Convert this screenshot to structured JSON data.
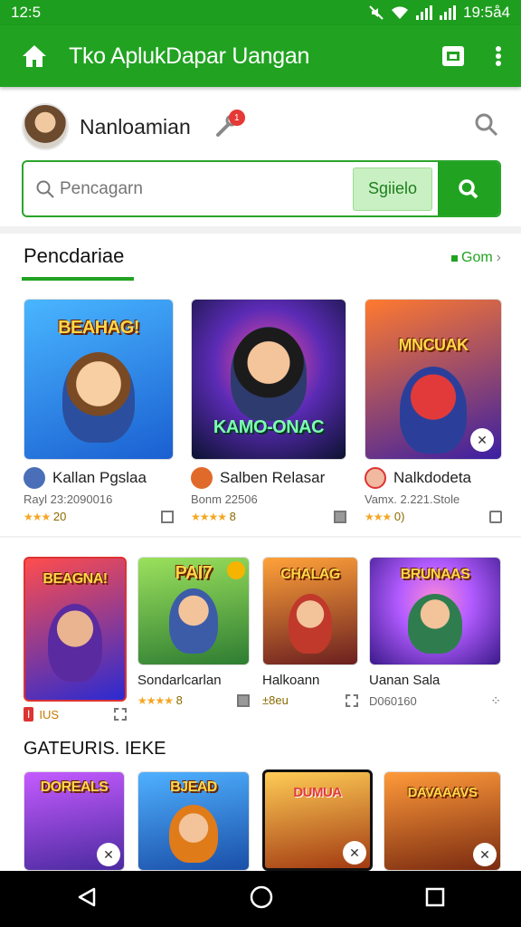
{
  "status": {
    "time_left": "12:5",
    "time_right": "19:5å4"
  },
  "appbar": {
    "title": "Tko AplukDapar Uangan"
  },
  "profile": {
    "name": "Nanloamian",
    "badge": "1"
  },
  "search": {
    "placeholder": "Pencagarn",
    "button": "Sgiielo"
  },
  "section1": {
    "title": "Pencdariae",
    "more": "Gom"
  },
  "row1": [
    {
      "thumb_text": "BEAHAG!",
      "name": "Kallan Pgslaa",
      "meta": "Rayl 23:2090016",
      "rating": "20",
      "colors": [
        "#49b6ff",
        "#1a5fd1"
      ]
    },
    {
      "thumb_text": "KAMO-ONAC",
      "name": "Salben Relasar",
      "meta": "Bonm 22506",
      "rating": "8",
      "colors": [
        "#5b2bb5",
        "#0b1230"
      ]
    },
    {
      "thumb_text": "MNCUAK",
      "name": "Nalkdodeta",
      "meta": "Vamx. 2.221.Stole",
      "rating": "0)",
      "colors": [
        "#ff7a2f",
        "#3b1fa3"
      ]
    }
  ],
  "row2": [
    {
      "thumb_text": "BEAGNA!",
      "name": "",
      "meta": "IUS",
      "colors": [
        "#ff4d4d",
        "#2b2ad1"
      ]
    },
    {
      "thumb_text": "PAI7",
      "name": "Sondarlcarlan",
      "rating": "8",
      "colors": [
        "#9be15d",
        "#2e7d32"
      ]
    },
    {
      "thumb_text": "CHALAG",
      "name": "Halkoann",
      "meta": "±8eu",
      "colors": [
        "#ffa23a",
        "#6b1f1f"
      ]
    },
    {
      "thumb_text": "BRUNAAS",
      "name": "Uanan Sala",
      "meta": "D060160",
      "colors": [
        "#b25bff",
        "#3a1a8a"
      ]
    }
  ],
  "section2": {
    "title": "GATEURIS. IEKE"
  },
  "row3": [
    {
      "thumb_text": "DOREALS",
      "colors": [
        "#c55bff",
        "#4b2aa0"
      ]
    },
    {
      "thumb_text": "BJEAD",
      "colors": [
        "#4fb0ff",
        "#1a4fa8"
      ]
    },
    {
      "thumb_text": "DUMUA",
      "colors": [
        "#ffcc55",
        "#a23a12"
      ]
    },
    {
      "thumb_text": "DAVAAAVS",
      "colors": [
        "#ff9a3a",
        "#7a2a10"
      ]
    }
  ]
}
